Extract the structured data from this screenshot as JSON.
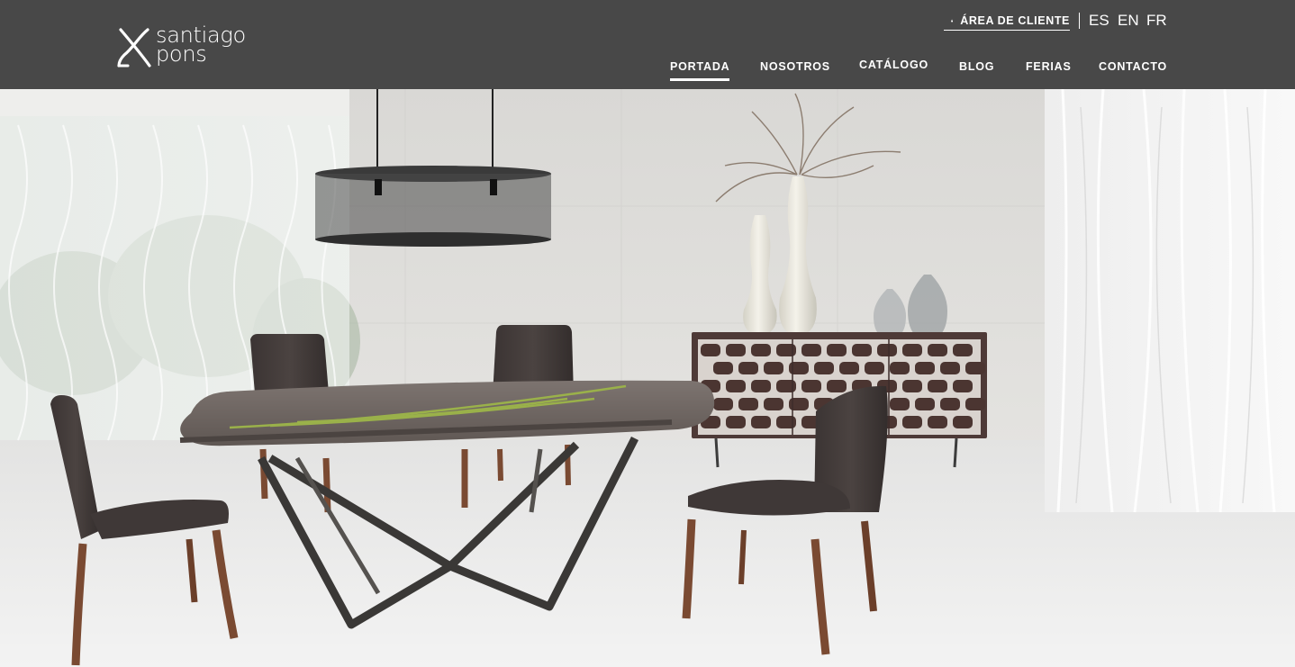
{
  "brand": {
    "name_line1": "santiago",
    "name_line2": "pons"
  },
  "header": {
    "client_area_label": "ÁREA DE CLIENTE",
    "languages": [
      "ES",
      "EN",
      "FR"
    ]
  },
  "nav": {
    "items": [
      {
        "label": "PORTADA",
        "active": true
      },
      {
        "label": "NOSOTROS",
        "active": false
      },
      {
        "label": "CATÁLOGO",
        "active": false
      },
      {
        "label": "BLOG",
        "active": false
      },
      {
        "label": "FERIAS",
        "active": false
      },
      {
        "label": "CONTACTO",
        "active": false
      }
    ]
  },
  "colors": {
    "header_bg": "#484848",
    "text": "#ffffff"
  },
  "icons": {
    "lock": "lock-icon",
    "logo": "logo-x-mark"
  }
}
